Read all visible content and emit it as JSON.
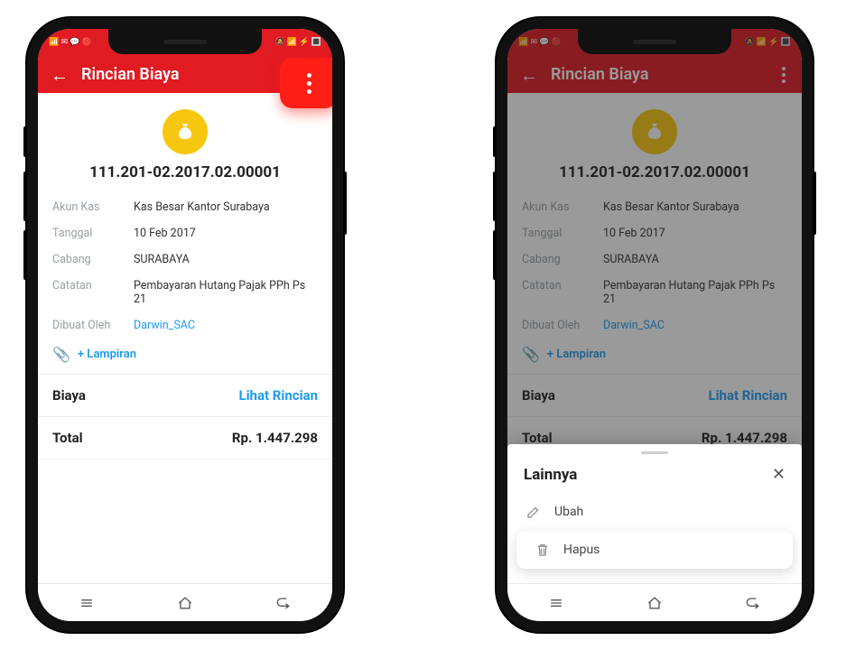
{
  "header": {
    "title": "Rincian Biaya"
  },
  "doc": {
    "id": "111.201-02.2017.02.00001",
    "fields": {
      "akun_kas_label": "Akun Kas",
      "akun_kas": "Kas Besar Kantor Surabaya",
      "tanggal_label": "Tanggal",
      "tanggal": "10 Feb 2017",
      "cabang_label": "Cabang",
      "cabang": "SURABAYA",
      "catatan_label": "Catatan",
      "catatan": "Pembayaran Hutang Pajak PPh Ps 21",
      "dibuat_label": "Dibuat Oleh",
      "dibuat": "Darwin_SAC"
    }
  },
  "attachment": {
    "label": "+ Lampiran"
  },
  "biaya": {
    "label": "Biaya",
    "link": "Lihat Rincian"
  },
  "total": {
    "label": "Total",
    "amount": "Rp. 1.447.298"
  },
  "sheet": {
    "title": "Lainnya",
    "ubah": "Ubah",
    "hapus": "Hapus"
  }
}
